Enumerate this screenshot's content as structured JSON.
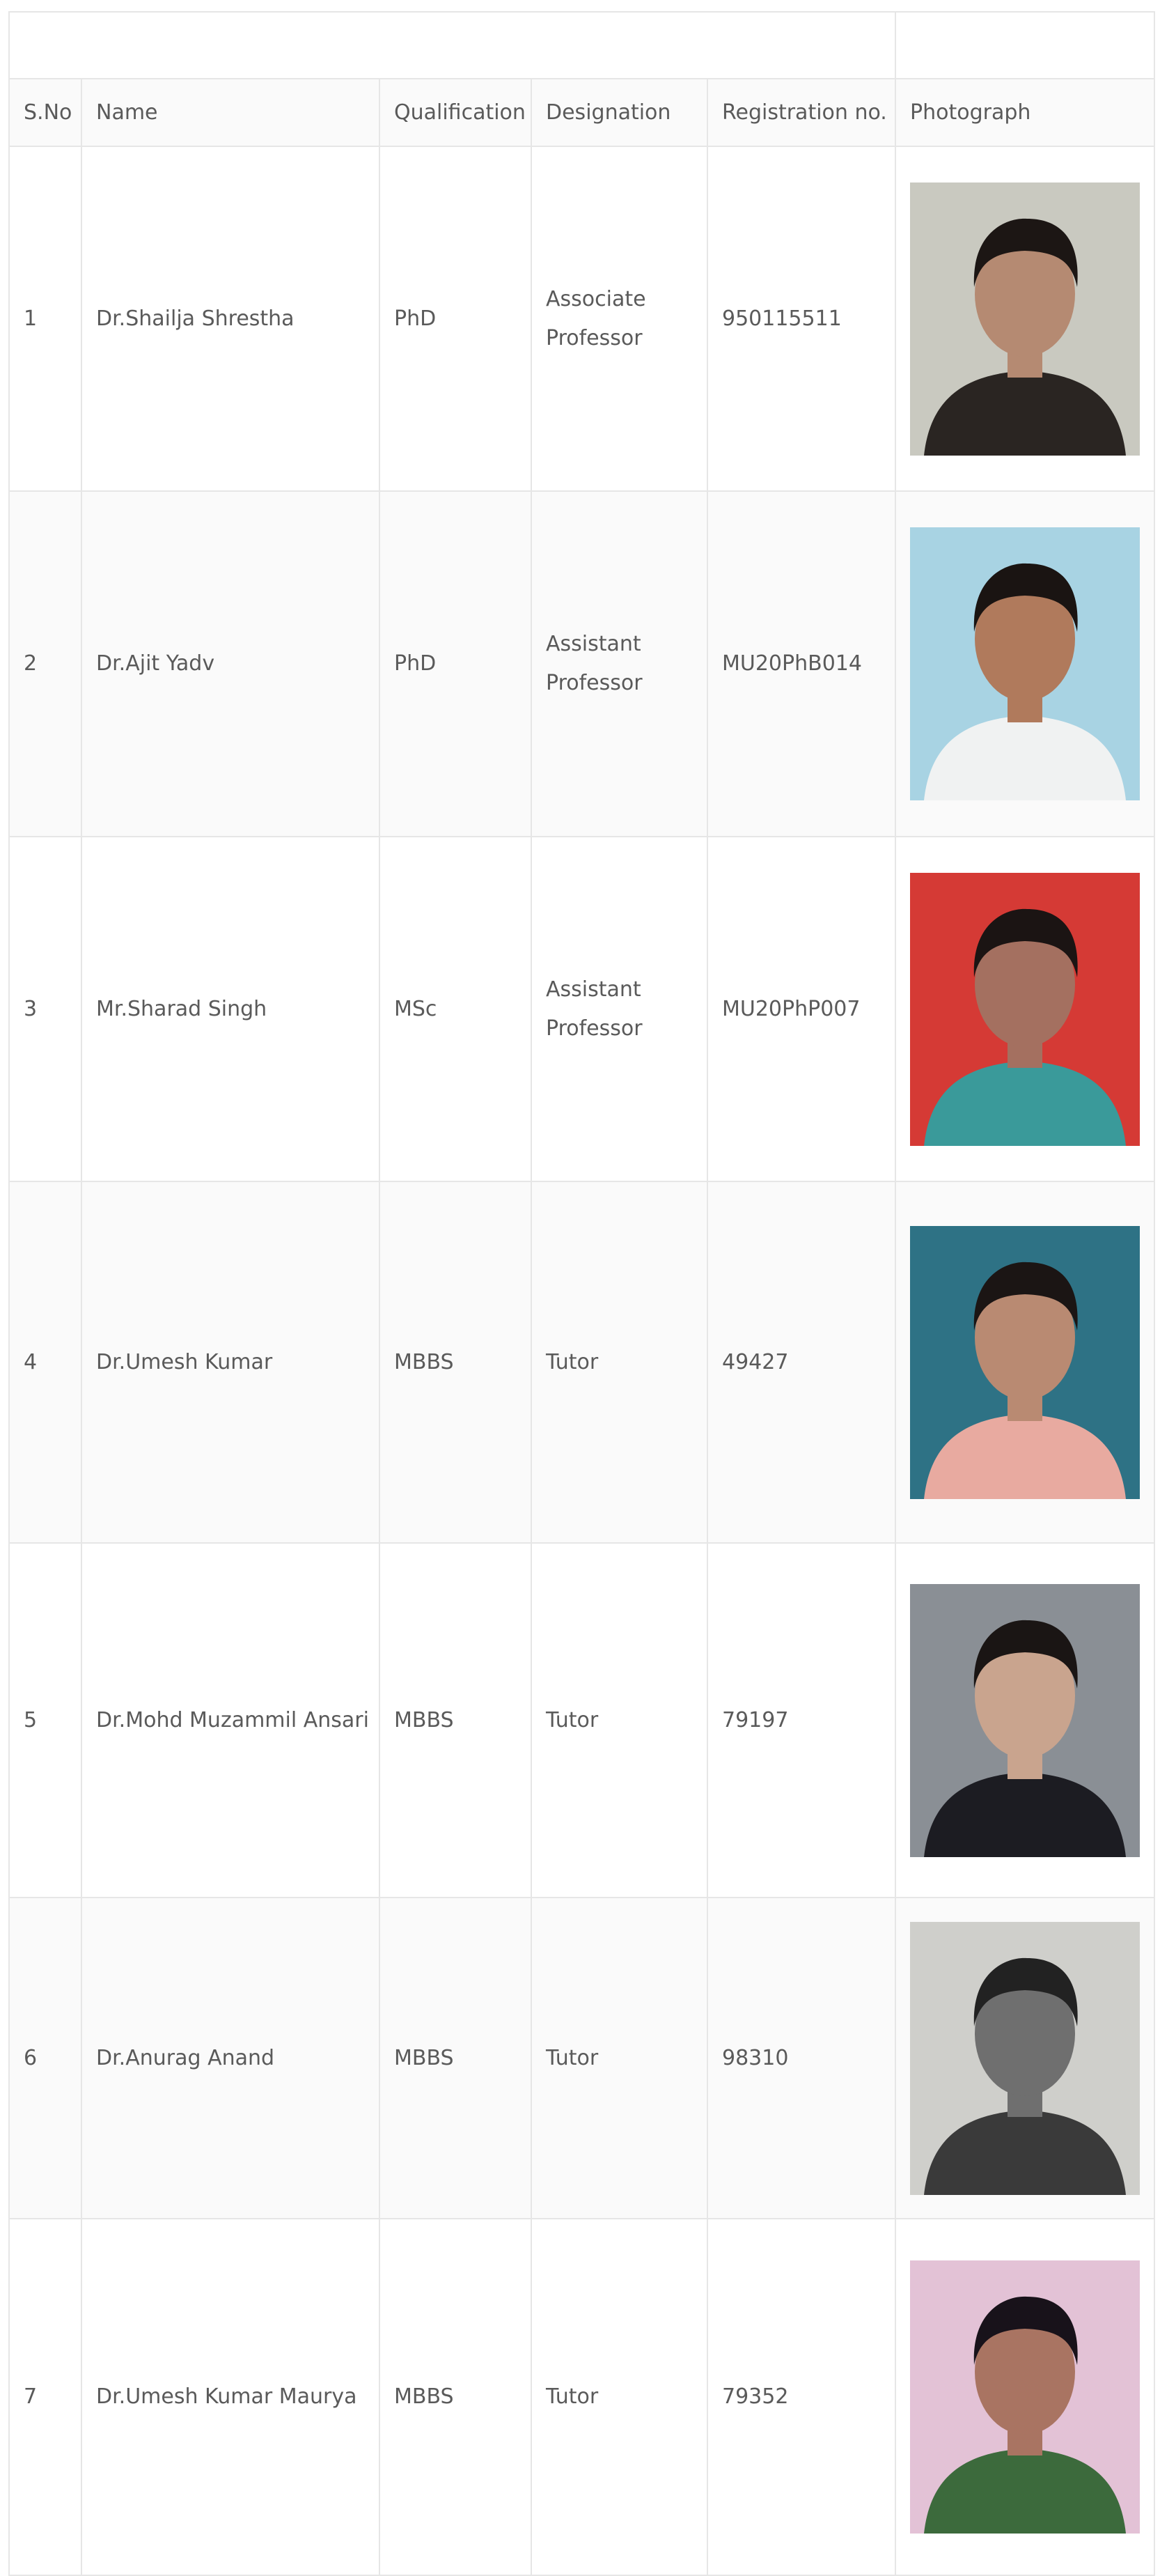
{
  "columns": {
    "sno": "S.No",
    "name": "Name",
    "qualification": "Qualification",
    "designation": "Designation",
    "registration": "Registration no.",
    "photograph": "Photograph"
  },
  "rows": [
    {
      "sno": "1",
      "name": "Dr.Shailja Shrestha",
      "qualification": "PhD",
      "designation": "Associate Professor",
      "registration": "950115511",
      "photo_icon": "person-photo-icon",
      "bg": "#c9c9c0",
      "shirt": "#2a2522",
      "skin": "#b58a72",
      "hair": "#1c1614"
    },
    {
      "sno": "2",
      "name": "Dr.Ajit Yadv",
      "qualification": "PhD",
      "designation": "Assistant Professor",
      "registration": "MU20PhB014",
      "photo_icon": "person-photo-icon",
      "bg": "#a8d3e3",
      "shirt": "#f0f2f2",
      "skin": "#b07a5c",
      "hair": "#1a1412"
    },
    {
      "sno": "3",
      "name": "Mr.Sharad Singh",
      "qualification": "MSc",
      "designation": "Assistant Professor",
      "registration": "MU20PhP007",
      "photo_icon": "person-photo-icon",
      "bg": "#d53a35",
      "shirt": "#3a9a9a",
      "skin": "#a47060",
      "hair": "#1b1413"
    },
    {
      "sno": "4",
      "name": "Dr.Umesh Kumar",
      "qualification": "MBBS",
      "designation": "Tutor",
      "registration": "49427",
      "photo_icon": "person-photo-icon",
      "bg": "#2e7285",
      "shirt": "#e8aaa0",
      "skin": "#b98a72",
      "hair": "#1b1514"
    },
    {
      "sno": "5",
      "name": "Dr.Mohd Muzammil Ansari",
      "qualification": "MBBS",
      "designation": "Tutor",
      "registration": "79197",
      "photo_icon": "person-photo-icon",
      "bg": "#8a8f95",
      "shirt": "#1c1c22",
      "skin": "#c9a48e",
      "hair": "#1a1514"
    },
    {
      "sno": "6",
      "name": "Dr.Anurag Anand",
      "qualification": "MBBS",
      "designation": "Tutor",
      "registration": "98310",
      "photo_icon": "person-photo-icon",
      "bg": "#cfcfcb",
      "shirt": "#3a3a3a",
      "skin": "#6f6f6f",
      "hair": "#222222"
    },
    {
      "sno": "7",
      "name": "Dr.Umesh Kumar Maurya",
      "qualification": "MBBS",
      "designation": "Tutor",
      "registration": "79352",
      "photo_icon": "person-photo-icon",
      "bg": "#e3c2d6",
      "shirt": "#3c6a3c",
      "skin": "#a97462",
      "hair": "#18121a"
    }
  ]
}
